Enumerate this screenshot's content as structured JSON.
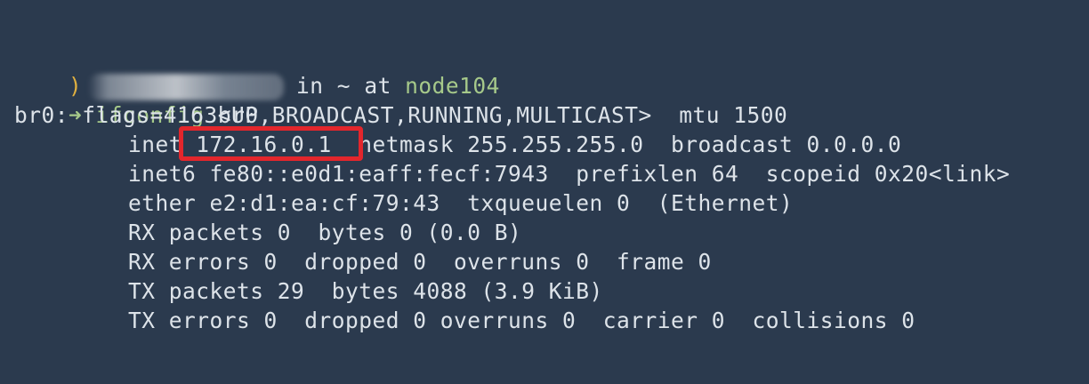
{
  "prompt": {
    "glyph": ")",
    "connector_in": "in",
    "cwd": "~",
    "connector_at": "at",
    "host": "node104"
  },
  "command": {
    "arrow": "➜",
    "name": "ifconfig",
    "arg": "br0"
  },
  "output": {
    "line1": "br0: flags=4163<UP,BROADCAST,RUNNING,MULTICAST>  mtu 1500",
    "line2_prefix": "inet ",
    "line2_ip": "172.16.0.1",
    "line2_rest": "  netmask 255.255.255.0  broadcast 0.0.0.0",
    "line3": "inet6 fe80::e0d1:eaff:fecf:7943  prefixlen 64  scopeid 0x20<link>",
    "line4": "ether e2:d1:ea:cf:79:43  txqueuelen 0  (Ethernet)",
    "line5": "RX packets 0  bytes 0 (0.0 B)",
    "line6": "RX errors 0  dropped 0  overruns 0  frame 0",
    "line7": "TX packets 29  bytes 4088 (3.9 KiB)",
    "line8": "TX errors 0  dropped 0 overruns 0  carrier 0  collisions 0"
  },
  "colors": {
    "background": "#2b3a4e",
    "text": "#dde3e9",
    "accent_green": "#a6c98a",
    "highlight_red": "#e3262c"
  }
}
